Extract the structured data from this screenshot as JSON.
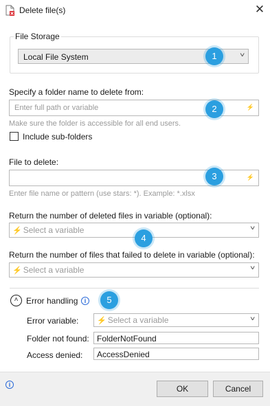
{
  "window": {
    "title": "Delete file(s)",
    "app_icon": "delete-file-icon",
    "close_icon": "close-icon"
  },
  "file_storage": {
    "legend": "File Storage",
    "selected": "Local File System"
  },
  "folder": {
    "label": "Specify a folder name to delete from:",
    "placeholder": "Enter full path or variable",
    "hint": "Make sure the folder is accessible for all end users.",
    "subfolders_label": "Include sub-folders",
    "subfolders_checked": false
  },
  "file": {
    "label": "File to delete:",
    "placeholder": "",
    "hint": "Enter file name or pattern (use stars: *). Example: *.xlsx"
  },
  "deleted_count": {
    "label": "Return the number of deleted files in variable (optional):",
    "placeholder": "Select a variable"
  },
  "failed_count": {
    "label": "Return the number of files that failed to delete in variable (optional):",
    "placeholder": "Select a variable"
  },
  "error_handling": {
    "title": "Error handling",
    "error_variable_label": "Error variable:",
    "error_variable_placeholder": "Select a variable",
    "folder_not_found_label": "Folder not found:",
    "folder_not_found_value": "FolderNotFound",
    "access_denied_label": "Access denied:",
    "access_denied_value": "AccessDenied"
  },
  "badges": [
    "1",
    "2",
    "3",
    "4",
    "5"
  ],
  "buttons": {
    "ok": "OK",
    "cancel": "Cancel"
  },
  "colors": {
    "badge": "#2b9fe0",
    "variable_bolt": "#2a6ad8"
  }
}
